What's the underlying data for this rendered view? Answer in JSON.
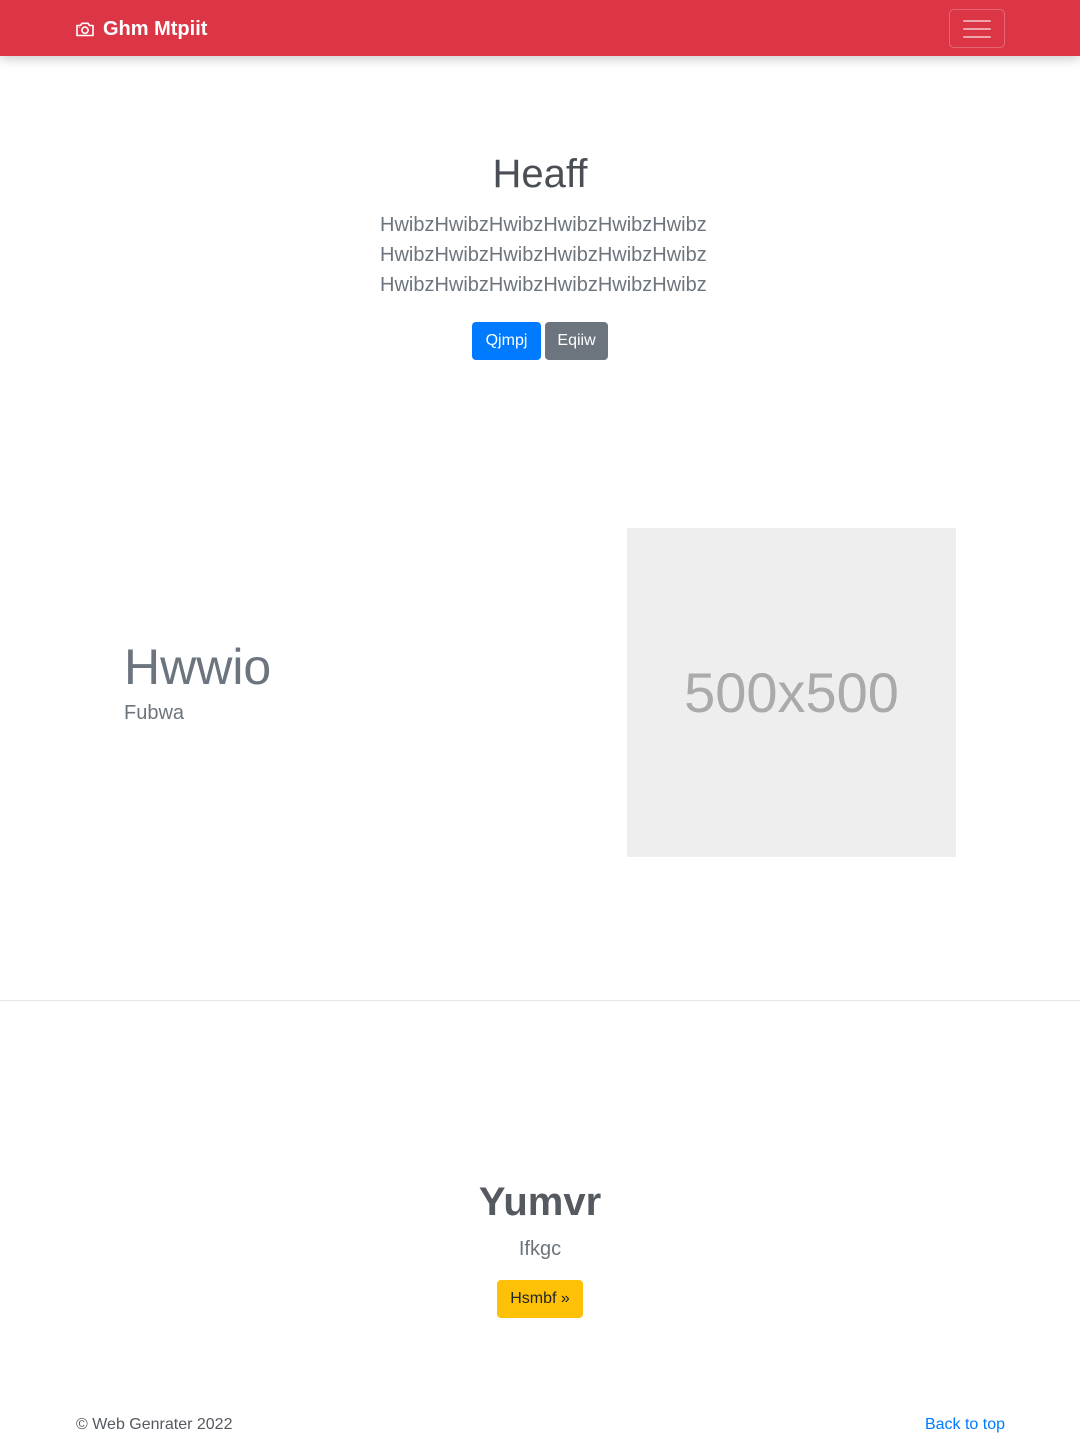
{
  "navbar": {
    "brand": "Ghm Mtpiit",
    "brand_icon": "camera-icon",
    "toggler_icon": "hamburger-menu-icon",
    "color": "#dc3545"
  },
  "hero": {
    "title": "Heaff",
    "lead": "HwibzHwibzHwibzHwibzHwibzHwibz HwibzHwibzHwibzHwibzHwibzHwibz HwibzHwibzHwibzHwibzHwibzHwibz",
    "primary_button": "Qjmpj",
    "secondary_button": "Eqiiw"
  },
  "feature": {
    "heading": "Hwwio",
    "text": "Fubwa",
    "image_placeholder": "500x500"
  },
  "cta": {
    "title": "Yumvr",
    "subtitle": "Ifkgc",
    "button": "Hsmbf »"
  },
  "footer": {
    "copyright": "© Web Genrater 2022",
    "back_to_top": "Back to top"
  },
  "colors": {
    "primary": "#007bff",
    "secondary": "#6c757d",
    "warning": "#ffc107",
    "danger": "#dc3545"
  }
}
